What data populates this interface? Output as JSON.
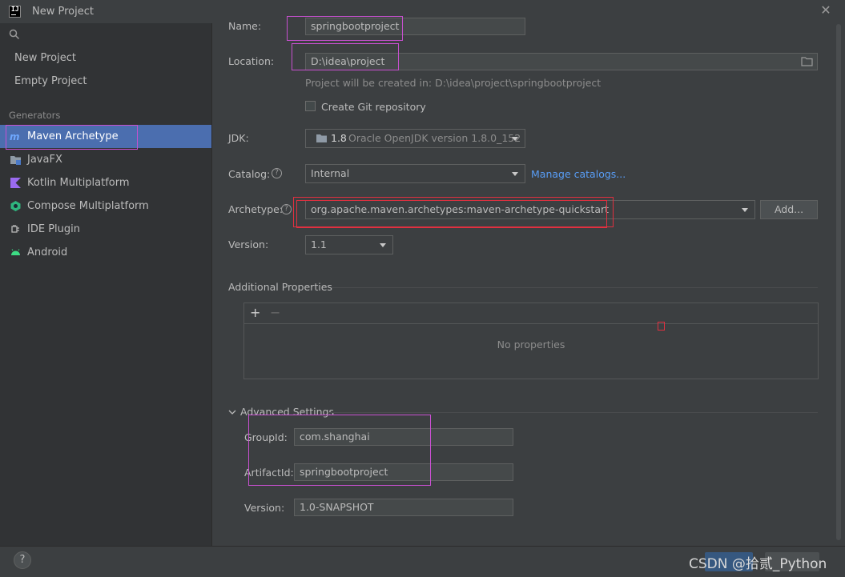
{
  "window": {
    "title": "New Project",
    "close_icon": "close-icon"
  },
  "sidebar": {
    "search_icon": "search-icon",
    "top_items": [
      {
        "label": "New Project"
      },
      {
        "label": "Empty Project"
      }
    ],
    "generators_header": "Generators",
    "generators": [
      {
        "label": "Maven Archetype",
        "icon": "maven-icon",
        "selected": true
      },
      {
        "label": "JavaFX",
        "icon": "folder-icon"
      },
      {
        "label": "Kotlin Multiplatform",
        "icon": "kotlin-icon"
      },
      {
        "label": "Compose Multiplatform",
        "icon": "compose-icon"
      },
      {
        "label": "IDE Plugin",
        "icon": "plugin-icon"
      },
      {
        "label": "Android",
        "icon": "android-icon"
      }
    ]
  },
  "form": {
    "name": {
      "label": "Name:",
      "value": "springbootproject"
    },
    "location": {
      "label": "Location:",
      "value": "D:\\idea\\project",
      "hint": "Project will be created in: D:\\idea\\project\\springbootproject"
    },
    "git": {
      "label": "Create Git repository",
      "checked": false
    },
    "jdk": {
      "label": "JDK:",
      "version": "1.8",
      "detail": "Oracle OpenJDK version 1.8.0_152"
    },
    "catalog": {
      "label": "Catalog:",
      "value": "Internal",
      "manage_link": "Manage catalogs..."
    },
    "archetype": {
      "label": "Archetype:",
      "value": "org.apache.maven.archetypes:maven-archetype-quickstart",
      "add_button": "Add..."
    },
    "version": {
      "label": "Version:",
      "value": "1.1"
    },
    "additional": {
      "title": "Additional Properties",
      "add": "+",
      "remove": "−",
      "empty": "No properties"
    },
    "advanced": {
      "title": "Advanced Settings",
      "group_id": {
        "label": "GroupId:",
        "value": "com.shanghai"
      },
      "artifact_id": {
        "label": "ArtifactId:",
        "value": "springbootproject"
      },
      "version": {
        "label": "Version:",
        "value": "1.0-SNAPSHOT"
      }
    }
  },
  "footer": {
    "help": "?",
    "watermark": "CSDN @拾贰_Python"
  },
  "colors": {
    "accent": "#4b6eaf",
    "link": "#589df6",
    "highlight": "#c850d0",
    "highlight_red": "#e03040"
  }
}
